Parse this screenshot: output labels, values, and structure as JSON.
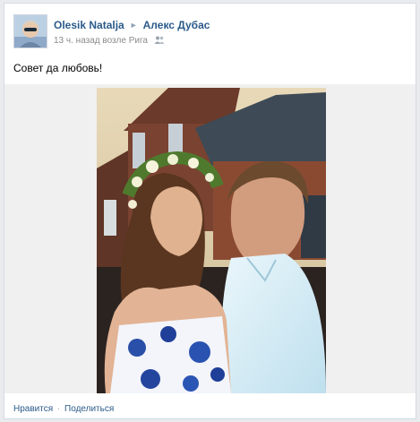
{
  "post": {
    "author": "Olesik Natalja",
    "recipient": "Алекс Дубас",
    "time": "13 ч. назад",
    "location_prefix": "возле",
    "location": "Рига",
    "text": "Совет да любовь!"
  },
  "footer": {
    "like_label": "Нравится",
    "separator": "·",
    "share_label": "Поделиться"
  },
  "colors": {
    "link": "#2b5a8a",
    "muted": "#8a8a8a"
  },
  "icons": [
    "arrow-right-icon",
    "people-icon"
  ]
}
